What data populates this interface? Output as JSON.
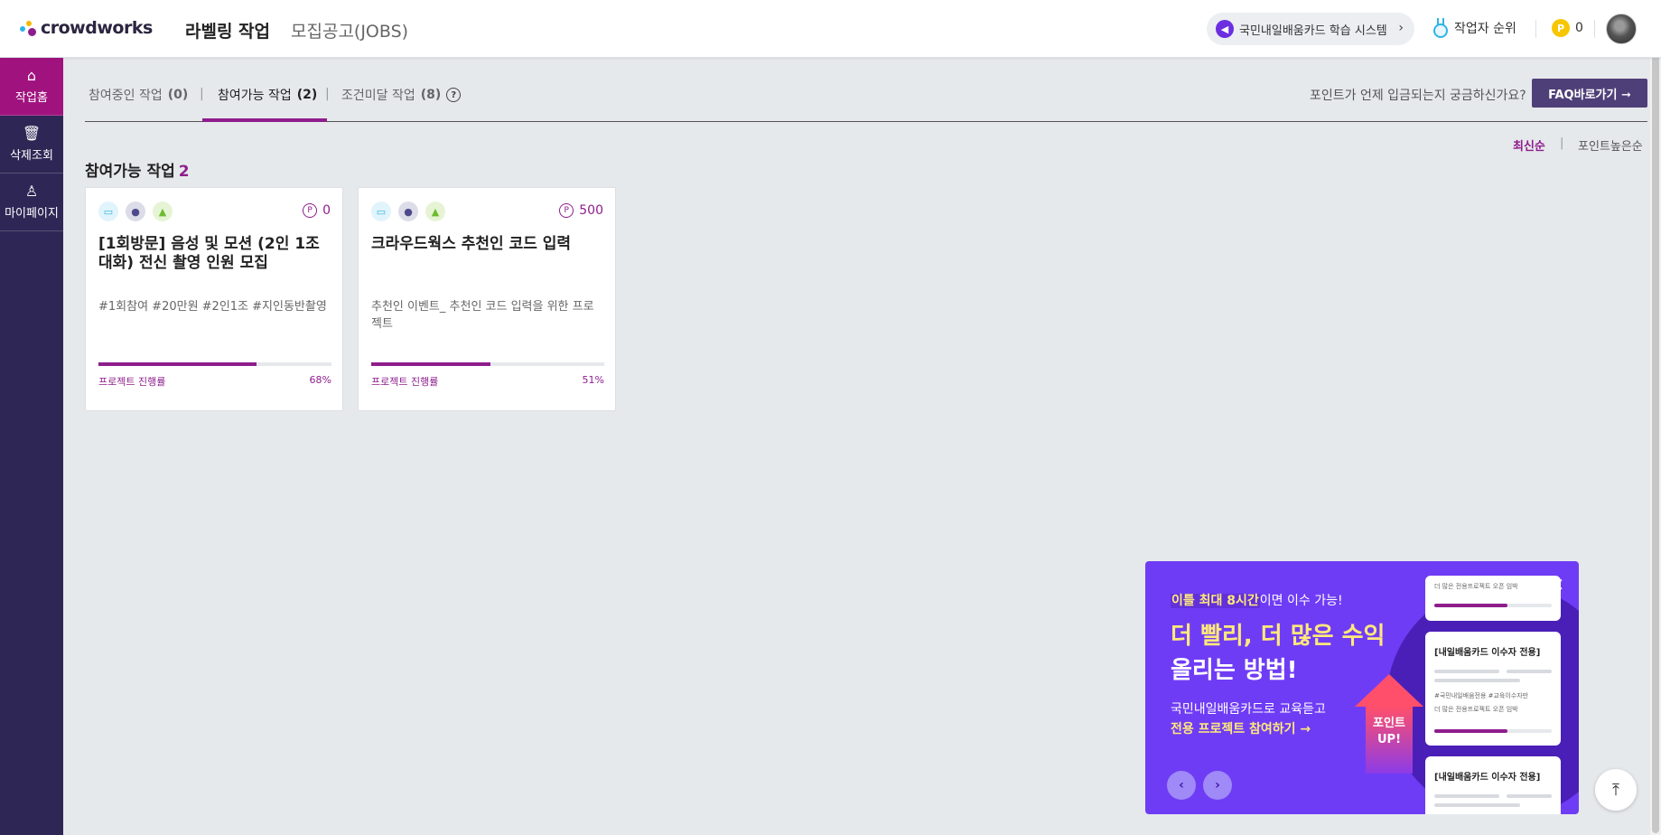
{
  "header": {
    "logo_text": "crowdworks",
    "nav_labeling": "라벨링 작업",
    "nav_jobs": "모집공고(JOBS)",
    "notice_pill": "국민내일배움카드 학습 시스템",
    "rank_label": "작업자 순위",
    "points": "0",
    "coin_symbol": "P"
  },
  "sidebar": {
    "items": [
      {
        "label": "작업홈",
        "icon": "home-icon"
      },
      {
        "label": "삭제조회",
        "icon": "trash-icon"
      },
      {
        "label": "마이페이지",
        "icon": "user-icon"
      }
    ]
  },
  "tabs": [
    {
      "label": "참여중인 작업",
      "count": "(0)"
    },
    {
      "label": "참여가능 작업",
      "count": "(2)"
    },
    {
      "label": "조건미달 작업",
      "count": "(8)"
    }
  ],
  "tab_separator": "|",
  "faq": {
    "question": "포인트가 언제 입금되는지 궁금하신가요?",
    "button": "FAQ바로가기 ➞"
  },
  "sort": {
    "latest": "최신순",
    "separator": "|",
    "points": "포인트높은순"
  },
  "section": {
    "title": "참여가능 작업",
    "count": "2"
  },
  "cards": [
    {
      "points": "0",
      "title": "[1회방문] 음성 및 모션 (2인 1조 대화) 전신 촬영 인원 모집",
      "desc": "#1회참여 #20만원 #2인1조 #지인동반촬영",
      "progress_label": "프로젝트 진행률",
      "progress_text": "68%",
      "progress": 68
    },
    {
      "points": "500",
      "title": "크라우드웍스 추천인 코드 입력",
      "desc": "추천인 이벤트_ 추천인 코드 입력을 위한 프로젝트",
      "progress_label": "프로젝트 진행률",
      "progress_text": "51%",
      "progress": 51
    }
  ],
  "banner": {
    "tag_highlight": "이틀 최대 8시간",
    "tag_rest": "이면 이수 가능!",
    "headline_1": "더 빨리, 더 많은 수익",
    "headline_2": "올리는 방법!",
    "sub_1": "국민내일배움카드로 교육듣고",
    "sub_2": "전용 프로젝트 참여하기 →",
    "arrow_line1": "포인트",
    "arrow_line2": "UP!",
    "mini_top_text": "더 많은 전용프로젝트 오픈 임박",
    "mini_card_title": "[내일배움카드 이수자 전용]",
    "mini_card_tags": "#국민내일배움전용 #교육이수자만",
    "mini_card_tags2": "더 많은 전용프로젝트 오픈 임박",
    "prev": "‹",
    "next": "›",
    "close": "✕"
  },
  "to_top": "⤒"
}
